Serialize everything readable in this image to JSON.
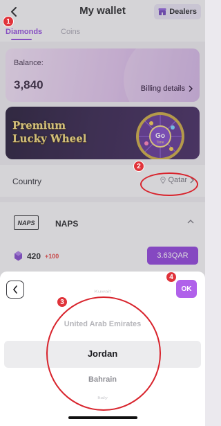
{
  "header": {
    "title": "My wallet",
    "back_icon": "chevron-left-icon",
    "dealers_label": "Dealers",
    "dealers_icon": "store-icon"
  },
  "tabs": [
    {
      "label": "Diamonds",
      "active": true
    },
    {
      "label": "Coins",
      "active": false
    }
  ],
  "balance": {
    "label": "Balance:",
    "value": "3,840",
    "billing_label": "Billing details"
  },
  "banner": {
    "line1": "Premium",
    "line2": "Lucky Wheel",
    "wheel_button": "Go",
    "wheel_sub": "Time"
  },
  "country": {
    "label": "Country",
    "value": "Qatar"
  },
  "payment_method": {
    "logo_text": "NAPS",
    "name": "NAPS",
    "pack": {
      "amount": "420",
      "bonus": "+100",
      "price": "3.63QAR"
    }
  },
  "picker": {
    "ok_label": "OK",
    "items": [
      "Kuwait",
      "United Arab Emirates",
      "Jordan",
      "Bahrain",
      "Italy"
    ],
    "selected": "Jordan"
  },
  "annotations": [
    "1",
    "2",
    "3",
    "4"
  ],
  "colors": {
    "accent": "#8a38d8",
    "ok_button": "#b061ea",
    "annotation": "#e0333a"
  }
}
